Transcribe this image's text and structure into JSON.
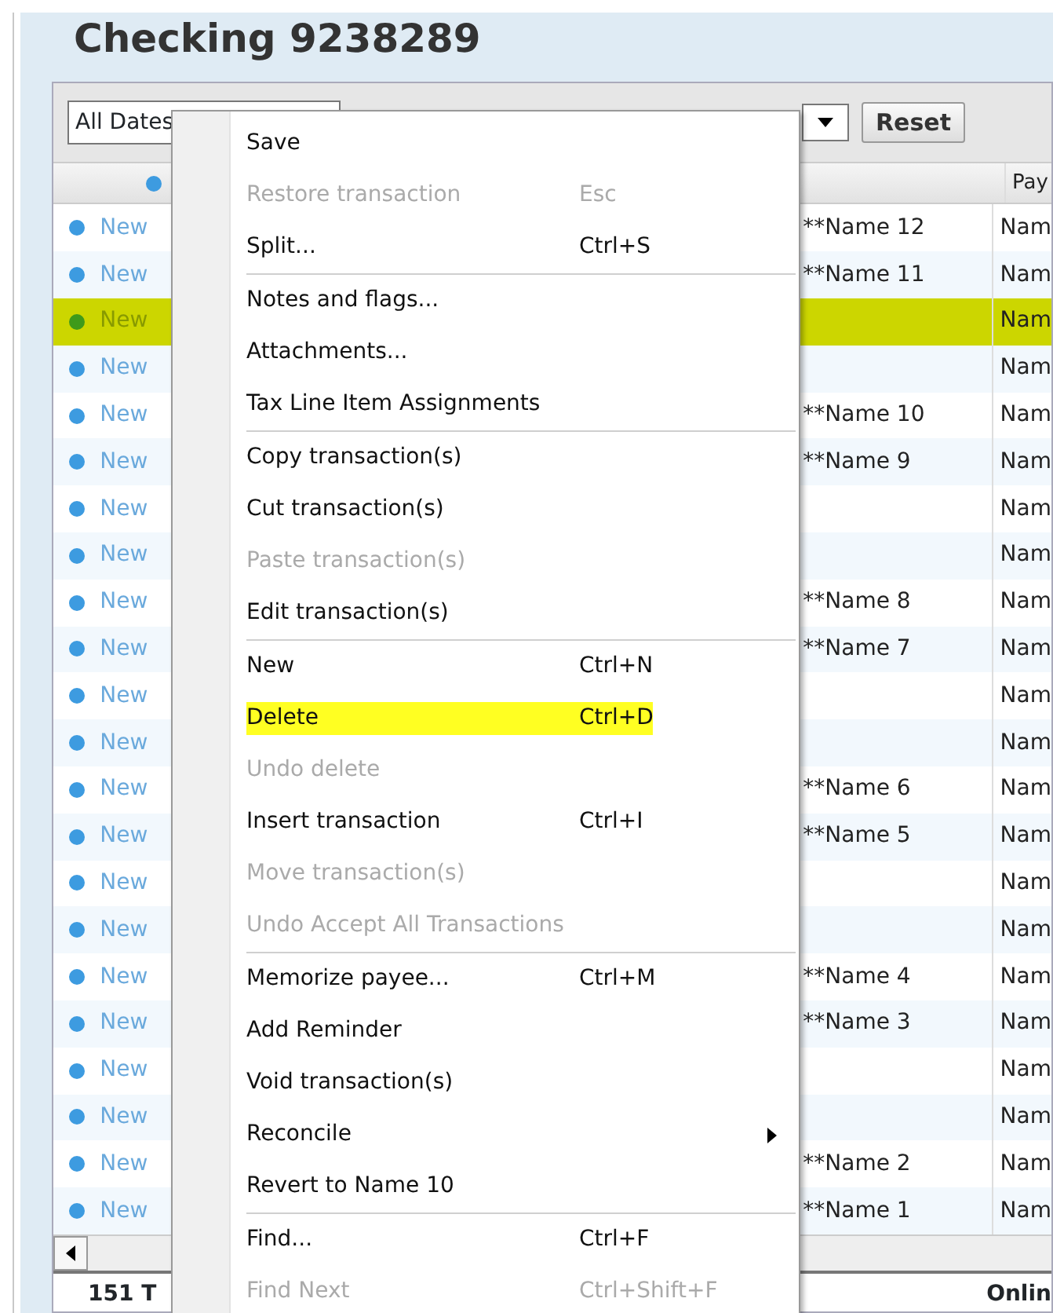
{
  "title": "Checking 9238289",
  "toolbar": {
    "date_filter": "All Dates",
    "reset_button": "Reset"
  },
  "table": {
    "header": {
      "column_4": "Pay"
    },
    "rows": [
      {
        "status": "New",
        "description": "**Name 12",
        "payee": "Nam",
        "selected": false
      },
      {
        "status": "New",
        "description": "**Name 11",
        "payee": "Nam",
        "selected": false
      },
      {
        "status": "New",
        "payee": "Nam",
        "selected": true
      },
      {
        "status": "New",
        "payee": "Nam",
        "selected": false
      },
      {
        "status": "New",
        "description": "**Name 10",
        "payee": "Nam",
        "selected": false
      },
      {
        "status": "New",
        "description": "**Name 9",
        "payee": "Nam",
        "selected": false
      },
      {
        "status": "New",
        "payee": "Nam",
        "selected": false
      },
      {
        "status": "New",
        "payee": "Nam",
        "selected": false
      },
      {
        "status": "New",
        "description": "**Name 8",
        "payee": "Nam",
        "selected": false
      },
      {
        "status": "New",
        "description": "**Name 7",
        "payee": "Nam",
        "selected": false
      },
      {
        "status": "New",
        "payee": "Nam",
        "selected": false
      },
      {
        "status": "New",
        "payee": "Nam",
        "selected": false
      },
      {
        "status": "New",
        "description": "**Name 6",
        "payee": "Nam",
        "selected": false
      },
      {
        "status": "New",
        "description": "**Name 5",
        "payee": "Nam",
        "selected": false
      },
      {
        "status": "New",
        "payee": "Nam",
        "selected": false
      },
      {
        "status": "New",
        "payee": "Nam",
        "selected": false
      },
      {
        "status": "New",
        "description": "**Name 4",
        "payee": "Nam",
        "selected": false
      },
      {
        "status": "New",
        "description": "**Name 3",
        "payee": "Nam",
        "selected": false
      },
      {
        "status": "New",
        "payee": "Nam",
        "selected": false
      },
      {
        "status": "New",
        "payee": "Nam",
        "selected": false
      },
      {
        "status": "New",
        "description": "**Name 2",
        "payee": "Nam",
        "selected": false
      },
      {
        "status": "New",
        "description": "**Name 1",
        "payee": "Nam",
        "selected": false
      }
    ],
    "footer": {
      "count": "151 T",
      "online": "Onlin"
    }
  },
  "context_menu": {
    "sections": [
      [
        {
          "label": "Save",
          "disabled": false,
          "highlighted": false
        },
        {
          "label": "Restore transaction",
          "shortcut": "Esc",
          "disabled": true,
          "highlighted": false
        },
        {
          "label": "Split...",
          "shortcut": "Ctrl+S",
          "disabled": false,
          "highlighted": false
        }
      ],
      [
        {
          "label": "Notes and flags...",
          "disabled": false,
          "highlighted": false
        },
        {
          "label": "Attachments...",
          "disabled": false,
          "highlighted": false
        },
        {
          "label": "Tax Line Item Assignments",
          "disabled": false,
          "highlighted": false
        }
      ],
      [
        {
          "label": "Copy transaction(s)",
          "disabled": false,
          "highlighted": false
        },
        {
          "label": "Cut transaction(s)",
          "disabled": false,
          "highlighted": false
        },
        {
          "label": "Paste transaction(s)",
          "disabled": true,
          "highlighted": false
        },
        {
          "label": "Edit transaction(s)",
          "disabled": false,
          "highlighted": false
        }
      ],
      [
        {
          "label": "New",
          "shortcut": "Ctrl+N",
          "disabled": false,
          "highlighted": false
        },
        {
          "label": "Delete",
          "shortcut": "Ctrl+D",
          "disabled": false,
          "highlighted": true
        },
        {
          "label": "Undo delete",
          "disabled": true,
          "highlighted": false
        },
        {
          "label": "Insert transaction",
          "shortcut": "Ctrl+I",
          "disabled": false,
          "highlighted": false
        },
        {
          "label": "Move transaction(s)",
          "disabled": true,
          "highlighted": false
        },
        {
          "label": "Undo Accept All Transactions",
          "disabled": true,
          "highlighted": false
        }
      ],
      [
        {
          "label": "Memorize payee...",
          "shortcut": "Ctrl+M",
          "disabled": false,
          "highlighted": false
        },
        {
          "label": "Add Reminder",
          "disabled": false,
          "highlighted": false
        },
        {
          "label": "Void transaction(s)",
          "disabled": false,
          "highlighted": false
        },
        {
          "label": "Reconcile",
          "disabled": false,
          "highlighted": false,
          "submenu": true
        },
        {
          "label": "Revert to Name 10",
          "disabled": false,
          "highlighted": false
        }
      ],
      [
        {
          "label": "Find...",
          "shortcut": "Ctrl+F",
          "disabled": false,
          "highlighted": false
        },
        {
          "label": "Find Next",
          "shortcut": "Ctrl+Shift+F",
          "disabled": true,
          "highlighted": false
        }
      ]
    ]
  }
}
